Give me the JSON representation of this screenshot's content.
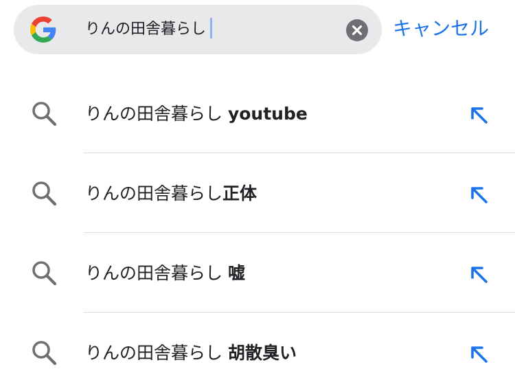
{
  "search": {
    "query": "りんの田舎暮らし",
    "cancel_label": "キャンセル"
  },
  "suggestions": [
    {
      "prefix": "りんの田舎暮らし ",
      "completion": "youtube"
    },
    {
      "prefix": "りんの田舎暮らし",
      "completion": "正体"
    },
    {
      "prefix": "りんの田舎暮らし ",
      "completion": "嘘"
    },
    {
      "prefix": "りんの田舎暮らし ",
      "completion": "胡散臭い"
    }
  ],
  "colors": {
    "accent": "#1a73e8",
    "search_bg": "#e9e9ec",
    "icon_gray": "#6f6f73"
  },
  "icons": {
    "logo": "google-g-icon",
    "clear": "clear-icon",
    "suggestion": "search-icon",
    "fill": "arrow-up-left-icon"
  }
}
